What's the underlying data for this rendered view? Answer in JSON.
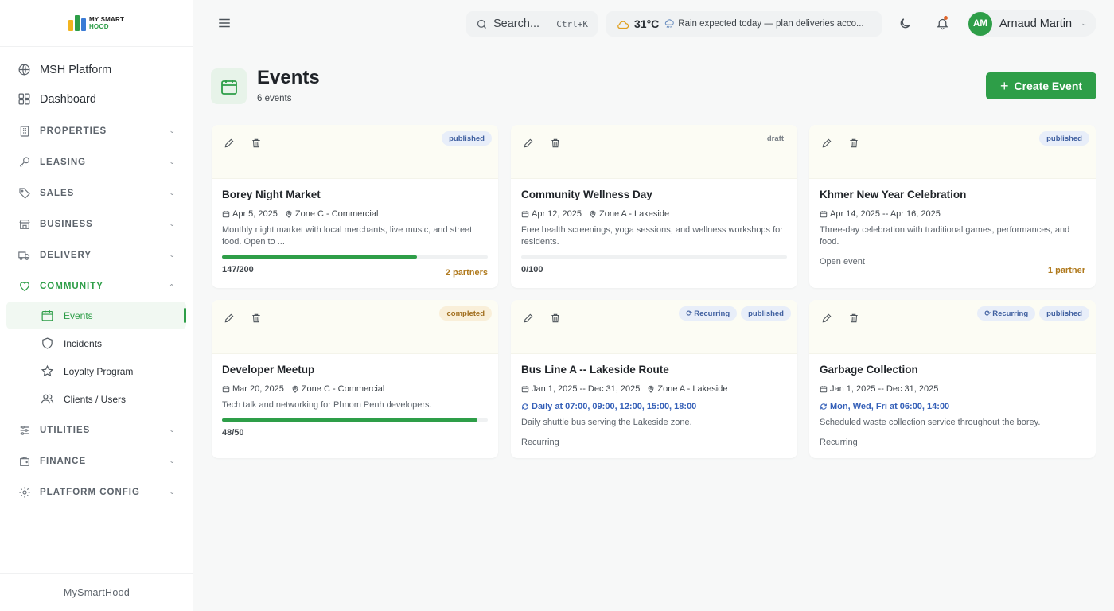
{
  "app": {
    "logo_line1": "MY SMART",
    "logo_line2": "HOOD",
    "footer": "MySmartHood",
    "accent": "#2e9e48"
  },
  "sidebar": {
    "top_items": [
      {
        "label": "MSH Platform",
        "icon": "globe-icon"
      },
      {
        "label": "Dashboard",
        "icon": "grid-icon"
      }
    ],
    "groups": [
      {
        "label": "PROPERTIES",
        "icon": "building-icon"
      },
      {
        "label": "LEASING",
        "icon": "key-icon"
      },
      {
        "label": "SALES",
        "icon": "tag-icon"
      },
      {
        "label": "BUSINESS",
        "icon": "store-icon"
      },
      {
        "label": "DELIVERY",
        "icon": "truck-icon"
      },
      {
        "label": "COMMUNITY",
        "icon": "heart-icon"
      },
      {
        "label": "UTILITIES",
        "icon": "sliders-icon"
      },
      {
        "label": "FINANCE",
        "icon": "wallet-icon"
      },
      {
        "label": "PLATFORM CONFIG",
        "icon": "gear-icon"
      }
    ],
    "community_items": [
      {
        "label": "Events",
        "icon": "calendar-icon"
      },
      {
        "label": "Incidents",
        "icon": "shield-icon"
      },
      {
        "label": "Loyalty Program",
        "icon": "star-icon"
      },
      {
        "label": "Clients / Users",
        "icon": "users-icon"
      }
    ]
  },
  "topbar": {
    "search_label": "Search...",
    "search_shortcut": "Ctrl+K",
    "temperature": "31°C",
    "weather_message": "Rain expected today — plan deliveries acco...",
    "user_initials": "AM",
    "user_name": "Arnaud Martin"
  },
  "page": {
    "title": "Events",
    "subtitle": "6 events",
    "create_label": "Create Event"
  },
  "events": [
    {
      "title": "Borey Night Market",
      "date": "Apr 5, 2025",
      "location": "Zone C - Commercial",
      "description": "Monthly night market with local merchants, live music, and street food. Open to ...",
      "status": "published",
      "capacity_label": "147/200",
      "progress": 0.735,
      "partners": "2 partners"
    },
    {
      "title": "Community Wellness Day",
      "date": "Apr 12, 2025",
      "location": "Zone A - Lakeside",
      "description": "Free health screenings, yoga sessions, and wellness workshops for residents.",
      "status": "draft",
      "capacity_label": "0/100",
      "progress": 0
    },
    {
      "title": "Khmer New Year Celebration",
      "date": "Apr 14, 2025 -- Apr 16, 2025",
      "description": "Three-day celebration with traditional games, performances, and food.",
      "status": "published",
      "open_label": "Open event",
      "partners": "1 partner"
    },
    {
      "title": "Developer Meetup",
      "date": "Mar 20, 2025",
      "location": "Zone C - Commercial",
      "description": "Tech talk and networking for Phnom Penh developers.",
      "status": "completed",
      "capacity_label": "48/50",
      "progress": 0.96
    },
    {
      "title": "Bus Line A -- Lakeside Route",
      "date": "Jan 1, 2025 -- Dec 31, 2025",
      "location": "Zone A - Lakeside",
      "schedule": "Daily at 07:00, 09:00, 12:00, 15:00, 18:00",
      "description": "Daily shuttle bus serving the Lakeside zone.",
      "recurring_badge": "Recurring",
      "status": "published",
      "open_label": "Recurring"
    },
    {
      "title": "Garbage Collection",
      "date": "Jan 1, 2025 -- Dec 31, 2025",
      "schedule": "Mon, Wed, Fri at 06:00, 14:00",
      "description": "Scheduled waste collection service throughout the borey.",
      "recurring_badge": "Recurring",
      "status": "published",
      "open_label": "Recurring"
    }
  ]
}
